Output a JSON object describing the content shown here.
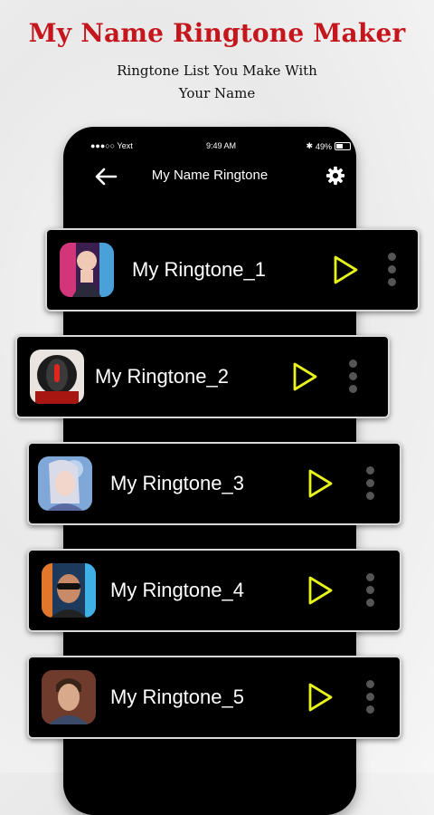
{
  "promo": {
    "title": "My Name Ringtone Maker",
    "subtitle_line1": "Ringtone List You Make With",
    "subtitle_line2": "Your Name"
  },
  "status_bar": {
    "carrier": "●●●○○ Yext",
    "time": "9:49 AM",
    "battery": "49%"
  },
  "header": {
    "title": "My Name Ringtone",
    "back_icon": "arrow-left-icon",
    "settings_icon": "gear-icon"
  },
  "colors": {
    "promo_title": "#c4161c",
    "play_accent": "#e8f21b",
    "card_background": "#000000"
  },
  "ringtones": [
    {
      "name": "My Ringtone_1",
      "play_icon": "play-icon",
      "menu_icon": "more-vertical-icon"
    },
    {
      "name": "My Ringtone_2",
      "play_icon": "play-icon",
      "menu_icon": "more-vertical-icon"
    },
    {
      "name": "My Ringtone_3",
      "play_icon": "play-icon",
      "menu_icon": "more-vertical-icon"
    },
    {
      "name": "My Ringtone_4",
      "play_icon": "play-icon",
      "menu_icon": "more-vertical-icon"
    },
    {
      "name": "My Ringtone_5",
      "play_icon": "play-icon",
      "menu_icon": "more-vertical-icon"
    }
  ]
}
